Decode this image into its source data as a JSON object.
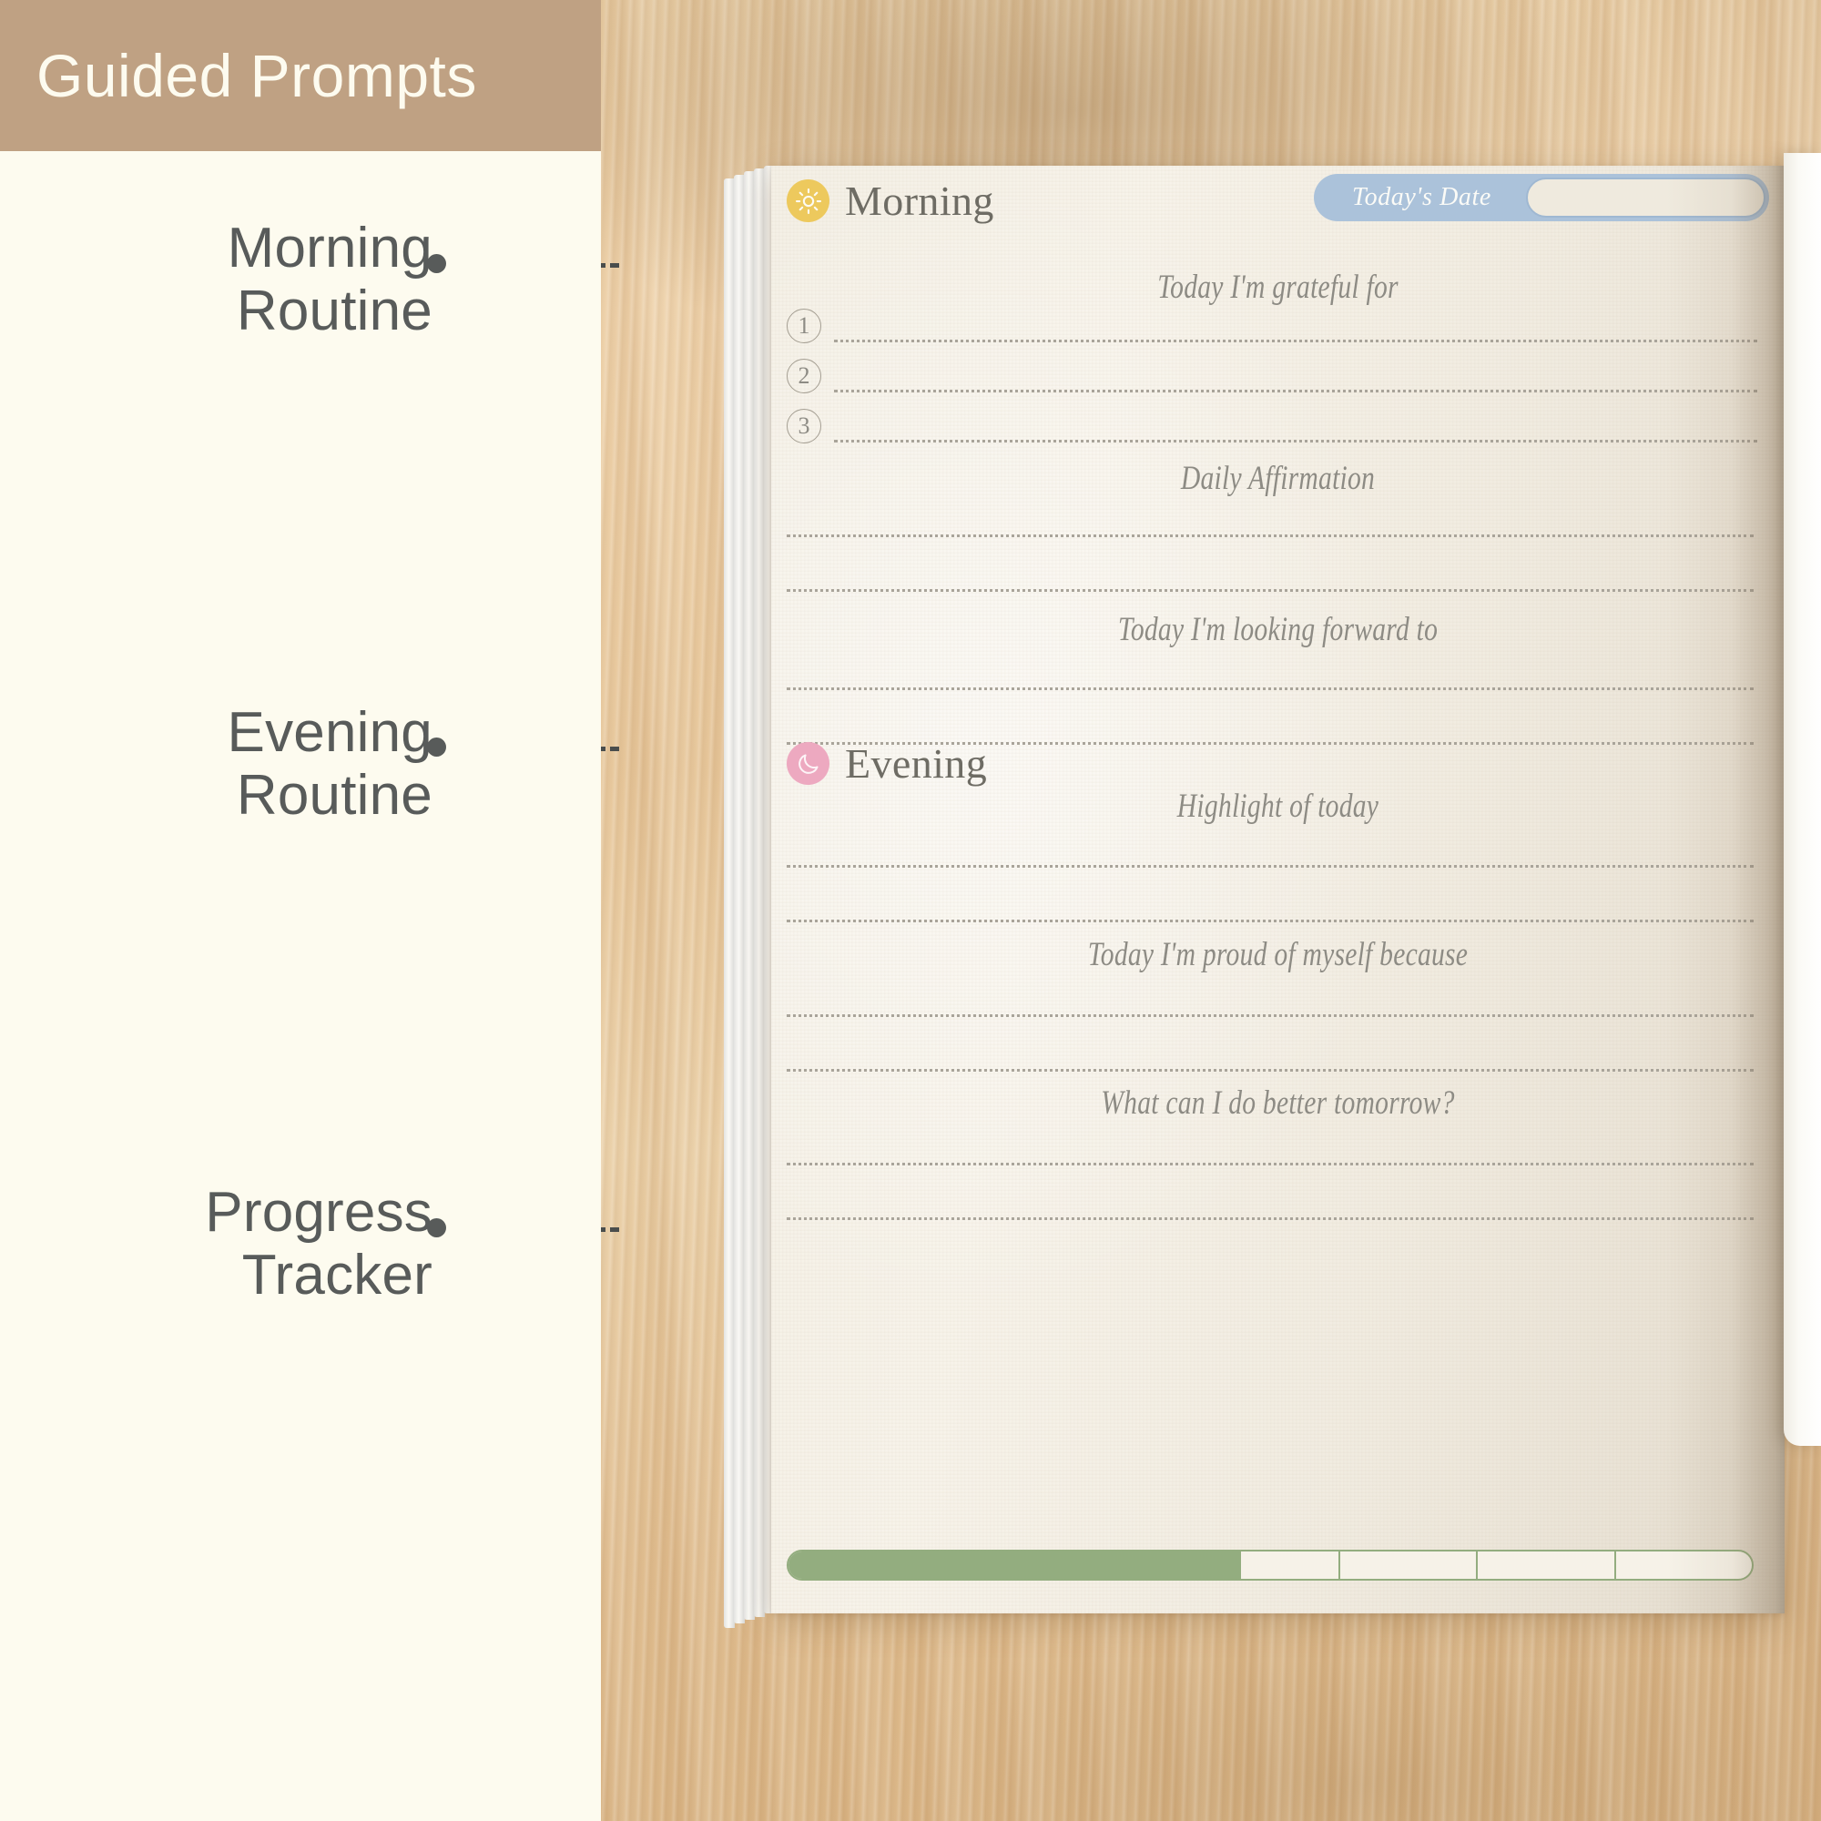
{
  "banner": {
    "title": "Guided Prompts"
  },
  "callouts": [
    {
      "label": "Morning\nRoutine",
      "name": "callout-morning-routine"
    },
    {
      "label": "Evening\nRoutine",
      "name": "callout-evening-routine"
    },
    {
      "label": "Progress\nTracker",
      "name": "callout-progress-tracker"
    }
  ],
  "journal": {
    "morning": {
      "title": "Morning",
      "icon": "sun-icon",
      "date_field": {
        "label": "Today's Date",
        "value": ""
      },
      "gratitude": {
        "prompt": "Today I'm grateful for",
        "items": [
          "1",
          "2",
          "3"
        ]
      },
      "affirmation": {
        "prompt": "Daily Affirmation",
        "lines": 2
      },
      "looking_forward": {
        "prompt": "Today I'm looking forward to",
        "lines": 2
      }
    },
    "evening": {
      "title": "Evening",
      "icon": "moon-icon",
      "highlight": {
        "prompt": "Highlight of today",
        "lines": 2
      },
      "proud": {
        "prompt": "Today I'm proud of myself because",
        "lines": 2
      },
      "better": {
        "prompt": "What can I do better tomorrow?",
        "lines": 2
      }
    },
    "tracker": {
      "segments": 7,
      "filled_percent": 47
    }
  },
  "colors": {
    "banner_bg": "#bfa183",
    "panel_bg": "#fdfbef",
    "sun_badge": "#edc95d",
    "moon_badge": "#eda9c0",
    "date_pill": "#abc2da",
    "tracker_green": "#93ad7f",
    "label_gray": "#585b5a",
    "paper": "#f4f0e6"
  }
}
